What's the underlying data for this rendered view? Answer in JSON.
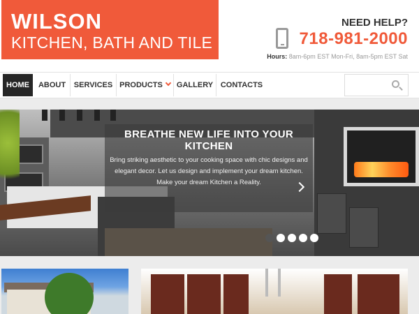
{
  "header": {
    "logo_title": "WILSON",
    "logo_subtitle": "KITCHEN, BATH AND TILE",
    "help_title": "NEED HELP?",
    "phone": "718-981-2000",
    "hours_label": "Hours:",
    "hours_text": "8am-6pm EST Mon-Fri, 8am-5pm EST Sat"
  },
  "nav": {
    "items": [
      {
        "label": "HOME",
        "active": true
      },
      {
        "label": "ABOUT"
      },
      {
        "label": "SERVICES"
      },
      {
        "label": "PRODUCTS",
        "has_dropdown": true
      },
      {
        "label": "GALLERY"
      },
      {
        "label": "CONTACTS"
      }
    ],
    "search_icon": "search-icon"
  },
  "hero": {
    "title": "BREATHE NEW LIFE INTO YOUR KITCHEN",
    "text": "Bring striking aesthetic to your cooking space with chic designs and elegant decor. Let us design and implement your dream kitchen. Make your dream Kitchen a Reality.",
    "next_icon": "chevron-right-icon",
    "slide_count": 5,
    "active_slide": 1
  },
  "colors": {
    "accent": "#f05a3a",
    "nav_active": "#262626",
    "page_bg": "#ececec"
  }
}
